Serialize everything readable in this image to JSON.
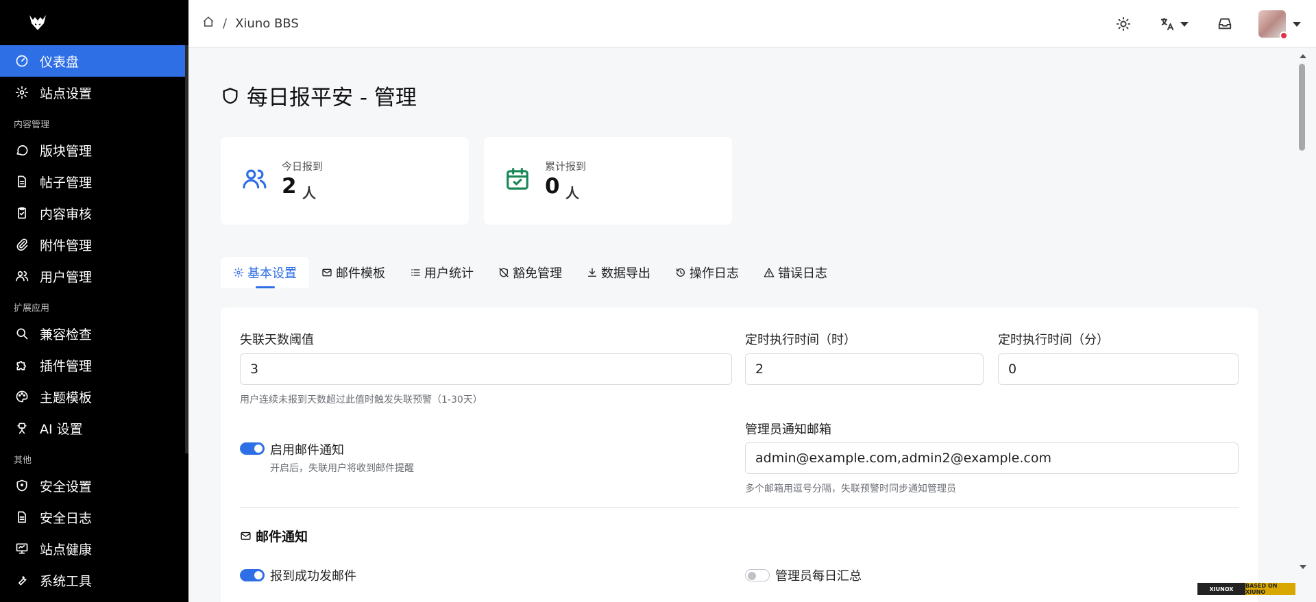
{
  "sidebar": {
    "logo": "xiuno-logo",
    "top_items": [
      {
        "label": "仪表盘",
        "icon": "dashboard-icon"
      },
      {
        "label": "站点设置",
        "icon": "gear-icon"
      }
    ],
    "sections": [
      {
        "title": "内容管理",
        "items": [
          {
            "label": "版块管理",
            "icon": "chat-icon"
          },
          {
            "label": "帖子管理",
            "icon": "document-icon"
          },
          {
            "label": "内容审核",
            "icon": "clipboard-check-icon"
          },
          {
            "label": "附件管理",
            "icon": "paperclip-icon"
          },
          {
            "label": "用户管理",
            "icon": "users-icon"
          }
        ]
      },
      {
        "title": "扩展应用",
        "items": [
          {
            "label": "兼容检查",
            "icon": "search-icon"
          },
          {
            "label": "插件管理",
            "icon": "puzzle-icon"
          },
          {
            "label": "主题模板",
            "icon": "palette-icon"
          },
          {
            "label": "AI 设置",
            "icon": "robot-icon"
          }
        ]
      },
      {
        "title": "其他",
        "items": [
          {
            "label": "安全设置",
            "icon": "shield-icon"
          },
          {
            "label": "安全日志",
            "icon": "log-icon"
          },
          {
            "label": "站点健康",
            "icon": "monitor-icon"
          },
          {
            "label": "系统工具",
            "icon": "tools-icon"
          }
        ]
      }
    ]
  },
  "topbar": {
    "breadcrumb_sep": "/",
    "breadcrumb_current": "Xiuno BBS",
    "icons": [
      "sun-icon",
      "translate-icon",
      "inbox-icon"
    ]
  },
  "page": {
    "title": "每日报平安 - 管理"
  },
  "stats": [
    {
      "label": "今日报到",
      "value": "2",
      "unit": "人",
      "icon": "users-icon",
      "color": "#2f6fe6"
    },
    {
      "label": "累计报到",
      "value": "0",
      "unit": "人",
      "icon": "calendar-check-icon",
      "color": "#198754"
    }
  ],
  "tabs": [
    {
      "label": "基本设置",
      "icon": "gear-icon"
    },
    {
      "label": "邮件模板",
      "icon": "mail-icon"
    },
    {
      "label": "用户统计",
      "icon": "list-icon"
    },
    {
      "label": "豁免管理",
      "icon": "shield-off-icon"
    },
    {
      "label": "数据导出",
      "icon": "download-icon"
    },
    {
      "label": "操作日志",
      "icon": "history-icon"
    },
    {
      "label": "错误日志",
      "icon": "warning-icon"
    }
  ],
  "form": {
    "threshold_label": "失联天数阈值",
    "threshold_value": "3",
    "threshold_help": "用户连续未报到天数超过此值时触发失联预警（1-30天）",
    "hour_label": "定时执行时间（时）",
    "hour_value": "2",
    "minute_label": "定时执行时间（分）",
    "minute_value": "0",
    "email_toggle_label": "启用邮件通知",
    "email_toggle_help": "开启后，失联用户将收到邮件提醒",
    "admin_email_label": "管理员通知邮箱",
    "admin_email_value": "admin@example.com,admin2@example.com",
    "admin_email_help": "多个邮箱用逗号分隔，失联预警时同步通知管理员",
    "section_mail": "邮件通知",
    "checkin_mail_label": "报到成功发邮件",
    "admin_daily_label": "管理员每日汇总"
  },
  "badge": {
    "left": "XIUNOX",
    "right": "BASED ON XIUNO"
  },
  "colors": {
    "accent": "#2f6fe6",
    "sidebar_bg": "#000000",
    "success": "#198754"
  }
}
